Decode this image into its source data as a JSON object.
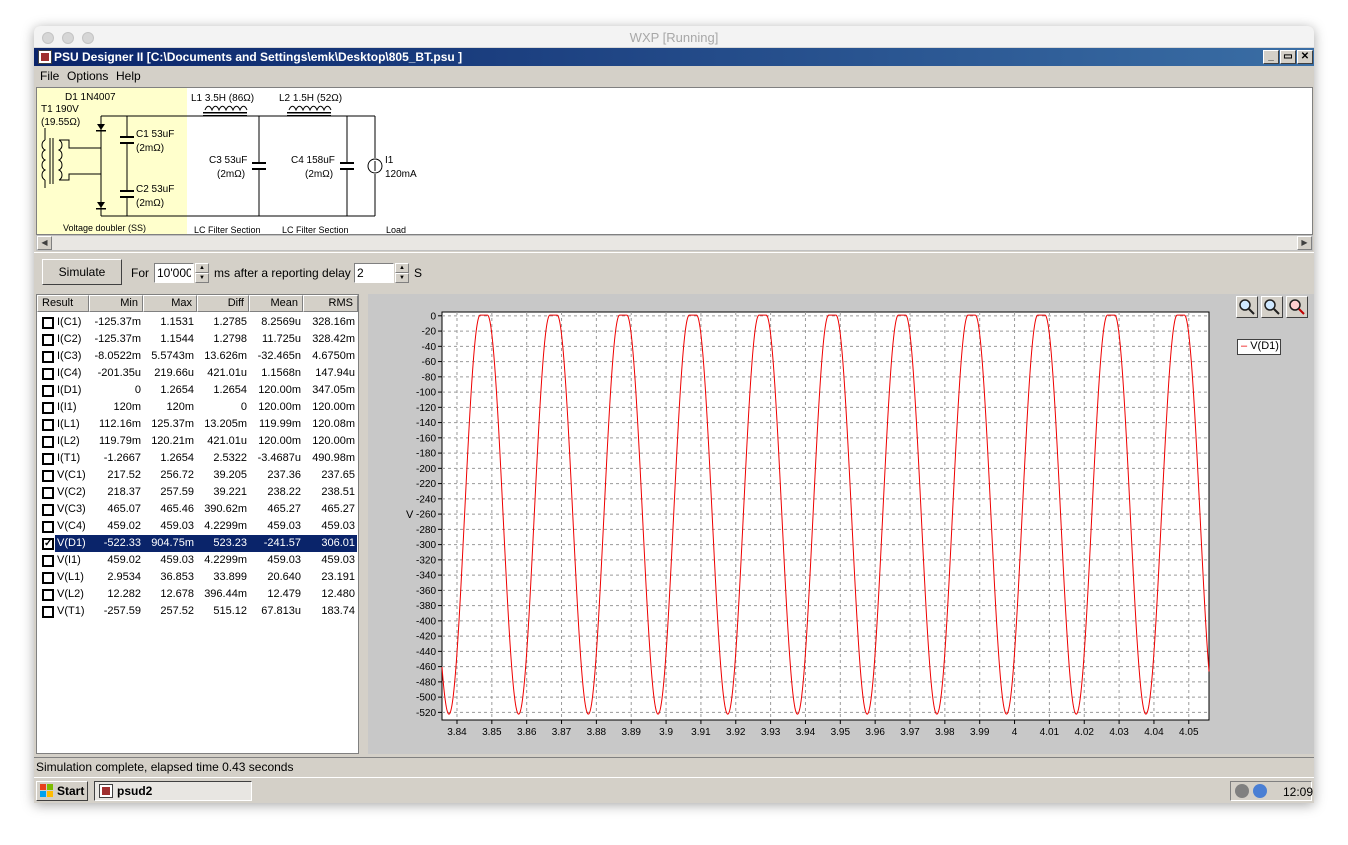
{
  "mac": {
    "title": "WXP [Running]"
  },
  "window": {
    "title": "PSU Designer II  [C:\\Documents and Settings\\emk\\Desktop\\805_BT.psu ]",
    "min": "_",
    "max": "▭",
    "close": "✕"
  },
  "menu": [
    "File",
    "Options",
    "Help"
  ],
  "schematic": {
    "d1": "D1 1N4007",
    "t1": "T1 190V",
    "t1r": "(19.55Ω)",
    "c1": "C1 53uF",
    "c1r": "(2mΩ)",
    "c2": "C2 53uF",
    "c2r": "(2mΩ)",
    "l1": "L1 3.5H (86Ω)",
    "l2": "L2 1.5H (52Ω)",
    "c3": "C3 53uF",
    "c3r": "(2mΩ)",
    "c4": "C4 158uF",
    "c4r": "(2mΩ)",
    "i1": "I1",
    "i1v": "120mA",
    "sec1": "Voltage doubler (SS)",
    "sec2": "LC Filter Section",
    "sec3": "LC Filter Section",
    "sec4": "Load"
  },
  "sim": {
    "button": "Simulate",
    "for_label": "For",
    "duration": "10'000",
    "ms_label": "ms",
    "delay_label": "after a reporting delay of",
    "delay": "2",
    "s_label": "S"
  },
  "results": {
    "headers": [
      "Result",
      "Min",
      "Max",
      "Diff",
      "Mean",
      "RMS"
    ],
    "rows": [
      {
        "name": "I(C1)",
        "min": "-125.37m",
        "max": "1.1531",
        "diff": "1.2785",
        "mean": "8.2569u",
        "rms": "328.16m",
        "checked": false
      },
      {
        "name": "I(C2)",
        "min": "-125.37m",
        "max": "1.1544",
        "diff": "1.2798",
        "mean": "11.725u",
        "rms": "328.42m",
        "checked": false
      },
      {
        "name": "I(C3)",
        "min": "-8.0522m",
        "max": "5.5743m",
        "diff": "13.626m",
        "mean": "-32.465n",
        "rms": "4.6750m",
        "checked": false
      },
      {
        "name": "I(C4)",
        "min": "-201.35u",
        "max": "219.66u",
        "diff": "421.01u",
        "mean": "1.1568n",
        "rms": "147.94u",
        "checked": false
      },
      {
        "name": "I(D1)",
        "min": "0",
        "max": "1.2654",
        "diff": "1.2654",
        "mean": "120.00m",
        "rms": "347.05m",
        "checked": false
      },
      {
        "name": "I(I1)",
        "min": "120m",
        "max": "120m",
        "diff": "0",
        "mean": "120.00m",
        "rms": "120.00m",
        "checked": false
      },
      {
        "name": "I(L1)",
        "min": "112.16m",
        "max": "125.37m",
        "diff": "13.205m",
        "mean": "119.99m",
        "rms": "120.08m",
        "checked": false
      },
      {
        "name": "I(L2)",
        "min": "119.79m",
        "max": "120.21m",
        "diff": "421.01u",
        "mean": "120.00m",
        "rms": "120.00m",
        "checked": false
      },
      {
        "name": "I(T1)",
        "min": "-1.2667",
        "max": "1.2654",
        "diff": "2.5322",
        "mean": "-3.4687u",
        "rms": "490.98m",
        "checked": false
      },
      {
        "name": "V(C1)",
        "min": "217.52",
        "max": "256.72",
        "diff": "39.205",
        "mean": "237.36",
        "rms": "237.65",
        "checked": false
      },
      {
        "name": "V(C2)",
        "min": "218.37",
        "max": "257.59",
        "diff": "39.221",
        "mean": "238.22",
        "rms": "238.51",
        "checked": false
      },
      {
        "name": "V(C3)",
        "min": "465.07",
        "max": "465.46",
        "diff": "390.62m",
        "mean": "465.27",
        "rms": "465.27",
        "checked": false
      },
      {
        "name": "V(C4)",
        "min": "459.02",
        "max": "459.03",
        "diff": "4.2299m",
        "mean": "459.03",
        "rms": "459.03",
        "checked": false
      },
      {
        "name": "V(D1)",
        "min": "-522.33",
        "max": "904.75m",
        "diff": "523.23",
        "mean": "-241.57",
        "rms": "306.01",
        "checked": true,
        "selected": true
      },
      {
        "name": "V(I1)",
        "min": "459.02",
        "max": "459.03",
        "diff": "4.2299m",
        "mean": "459.03",
        "rms": "459.03",
        "checked": false
      },
      {
        "name": "V(L1)",
        "min": "2.9534",
        "max": "36.853",
        "diff": "33.899",
        "mean": "20.640",
        "rms": "23.191",
        "checked": false
      },
      {
        "name": "V(L2)",
        "min": "12.282",
        "max": "12.678",
        "diff": "396.44m",
        "mean": "12.479",
        "rms": "12.480",
        "checked": false
      },
      {
        "name": "V(T1)",
        "min": "-257.59",
        "max": "257.52",
        "diff": "515.12",
        "mean": "67.813u",
        "rms": "183.74",
        "checked": false
      }
    ]
  },
  "chart_data": {
    "type": "line",
    "title": "",
    "xlabel": "",
    "ylabel": "V",
    "xlim": [
      3.8357,
      4.0558
    ],
    "ylim": [
      -530,
      5
    ],
    "x_ticks": [
      3.84,
      3.85,
      3.86,
      3.87,
      3.88,
      3.89,
      3.9,
      3.91,
      3.92,
      3.93,
      3.94,
      3.95,
      3.96,
      3.97,
      3.98,
      3.99,
      4,
      4.01,
      4.02,
      4.03,
      4.04,
      4.05
    ],
    "x_tick_labels": [
      "3.84",
      "3.85",
      "3.86",
      "3.87",
      "3.88",
      "3.89",
      "3.9",
      "3.91",
      "3.92",
      "3.93",
      "3.94",
      "3.95",
      "3.96",
      "3.97",
      "3.98",
      "3.99",
      "4",
      "4.01",
      "4.02",
      "4.03",
      "4.04",
      "4.05"
    ],
    "y_ticks": [
      0,
      -20,
      -40,
      -60,
      -80,
      -100,
      -120,
      -140,
      -160,
      -180,
      -200,
      -220,
      -240,
      -260,
      -280,
      -300,
      -320,
      -340,
      -360,
      -380,
      -400,
      -420,
      -440,
      -460,
      -480,
      -500,
      -520
    ],
    "grid": true,
    "legend": "top-right",
    "series": [
      {
        "name": "V(D1)",
        "color": "#ee0000",
        "min": -522.33,
        "max": 0.90475,
        "frequency_hz": 50,
        "clip_half_width": 0.00104,
        "trough_times": [
          3.8377,
          3.8577,
          3.8777,
          3.8977,
          3.9177,
          3.9377,
          3.9577,
          3.9777,
          3.9977,
          4.0177,
          4.0377
        ],
        "peak_times": [
          3.8477,
          3.8677,
          3.8877,
          3.9077,
          3.9277,
          3.9477,
          3.9677,
          3.9877,
          4.0077,
          4.0277,
          4.0477
        ]
      }
    ]
  },
  "status": "Simulation complete, elapsed time 0.43 seconds",
  "taskbar": {
    "start": "Start",
    "task": "psud2",
    "clock": "12:09"
  }
}
